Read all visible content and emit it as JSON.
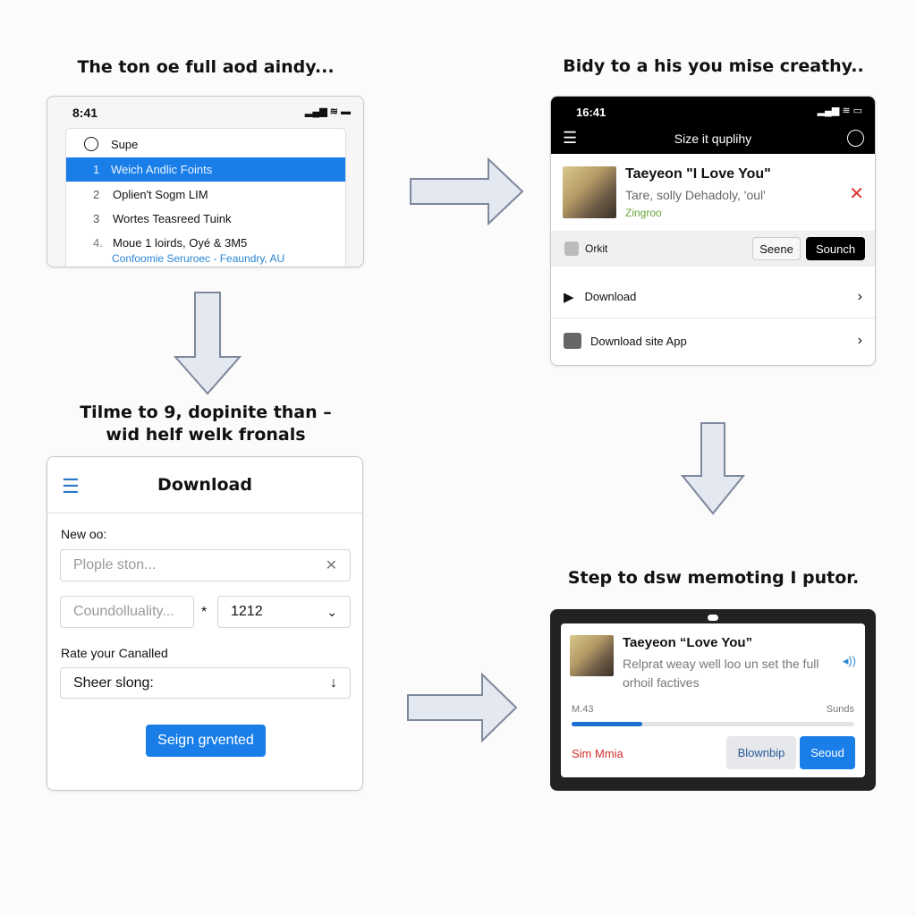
{
  "panel1": {
    "caption": "The ton oe full aod aindy...",
    "time": "8:41",
    "header_label": "Supe",
    "items": [
      {
        "num": "1",
        "label": "Weich Andlic Foints",
        "selected": true
      },
      {
        "num": "2",
        "label": "Oplien't Sogm LIM"
      },
      {
        "num": "3",
        "label": "Wortes Teasreed Tuink"
      },
      {
        "num": "4.",
        "label": "Moue 1 loirds, Oyé & 3M5",
        "sub": "Confoomie Seruroec - Feaundry, AU"
      }
    ],
    "accent": "#1a7ee8"
  },
  "panel2": {
    "caption": "Bidy to a his you mise creathy..",
    "time": "16:41",
    "title": "Size it quplihy",
    "song_title": "Taeyeon \"I Love You\"",
    "song_sub": "Tare, solly Dehadoly, 'oul'",
    "song_source": "Zingroo",
    "action_label": "Orkit",
    "btn_secondary": "Seene",
    "btn_primary": "Sounch",
    "menu": [
      {
        "label": "Download",
        "icon": "play-icon"
      },
      {
        "label": "Download site App",
        "icon": "app-icon"
      }
    ]
  },
  "panel3": {
    "caption_line1": "Tilme to 9, dopinite than –",
    "caption_line2": "wid helf welk fronals",
    "title": "Download",
    "label1": "New oo:",
    "input1_placeholder": "Plople ston...",
    "input2_placeholder": "Coundolluality...",
    "times": "*",
    "select_value": "1212",
    "label2": "Rate your Canalled",
    "select2_value": "Sheer slong:",
    "submit": "Seign grvented",
    "accent": "#1a7ee8"
  },
  "panel4": {
    "caption": "Step to dsw memoting I putor.",
    "song_title": "Taeyeon “Love You”",
    "desc": "Relprat weay well loo un set the full orhoil factives",
    "progress_left": "M.43",
    "progress_right": "Sunds",
    "progress": 0.25,
    "link": "Sim Mmia",
    "btn_secondary": "Blownbip",
    "btn_primary": "Seoud",
    "link_color": "#d12b2b"
  }
}
